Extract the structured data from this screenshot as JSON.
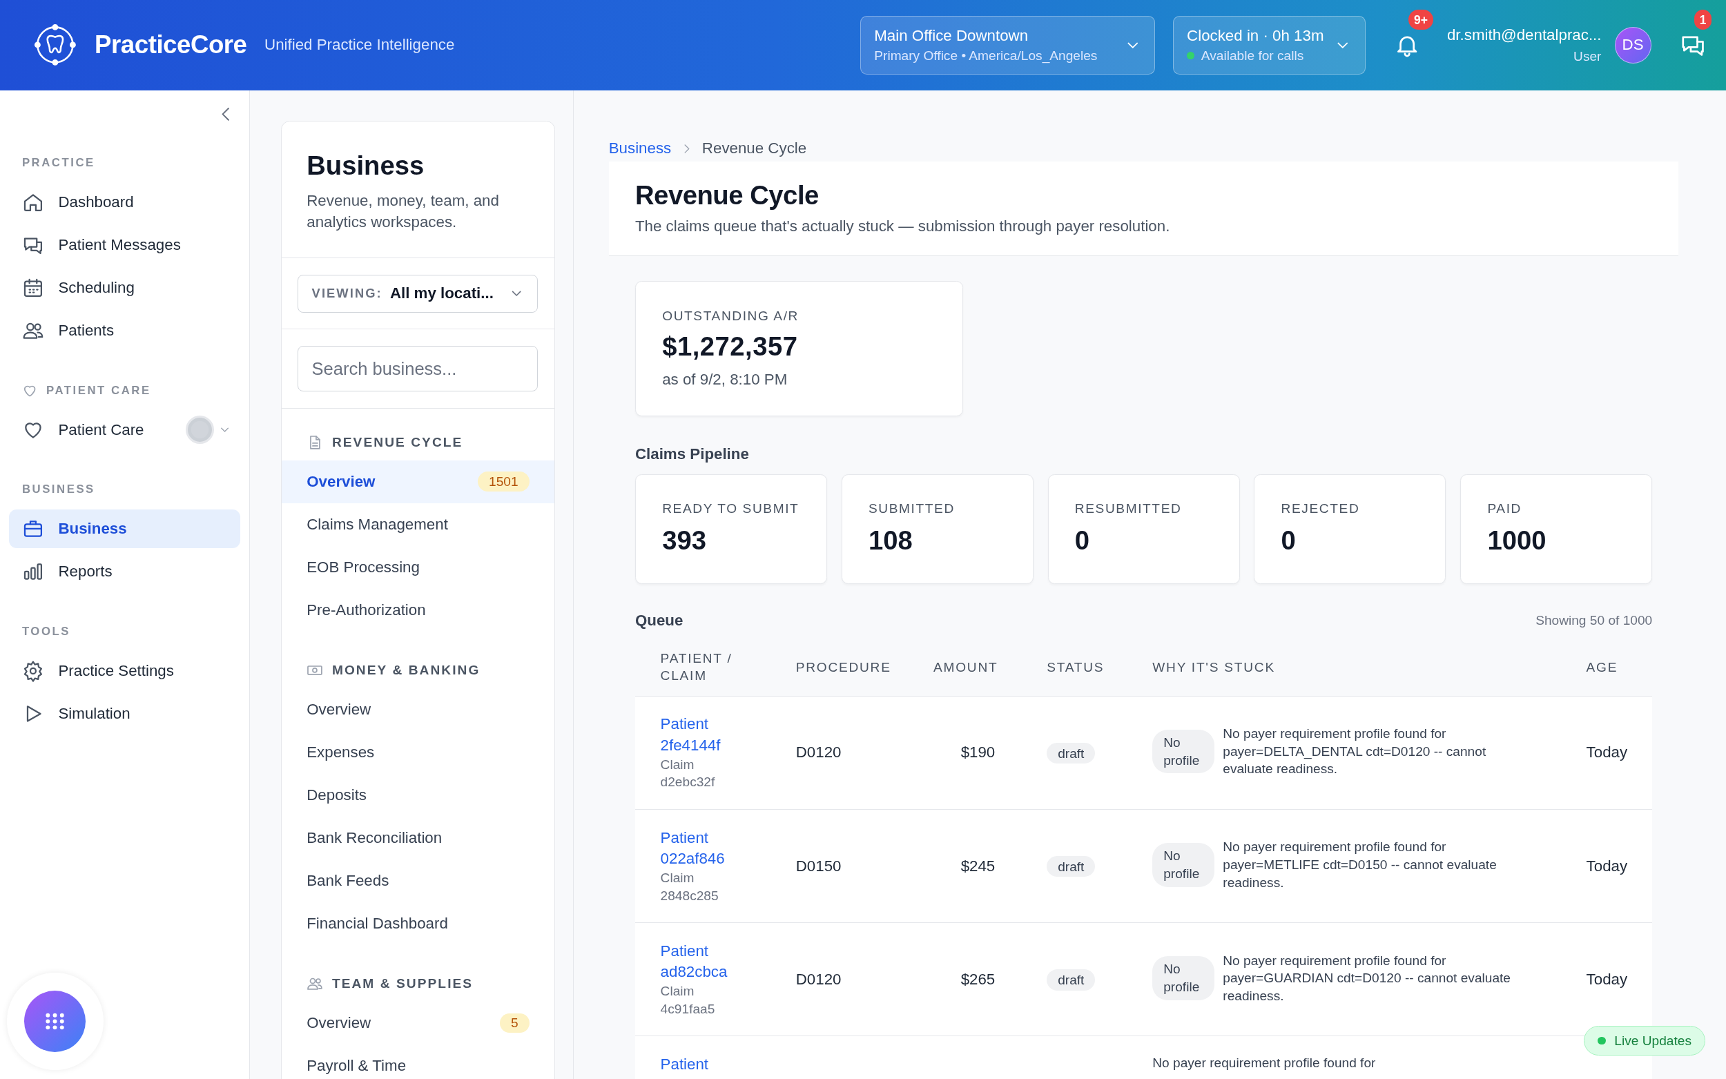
{
  "header": {
    "brand": "PracticeCore",
    "tagline": "Unified Practice Intelligence",
    "location": {
      "name": "Main Office Downtown",
      "detail": "Primary Office • America/Los_Angeles"
    },
    "clock": {
      "status": "Clocked in · 0h 13m",
      "availability": "Available for calls",
      "available": true
    },
    "notifications_badge": "9+",
    "user": {
      "email": "dr.smith@dentalprac...",
      "role": "User",
      "initials": "DS"
    },
    "messages_badge": "1"
  },
  "sidebar": {
    "sections": [
      {
        "label": "PRACTICE",
        "items": [
          {
            "label": "Dashboard",
            "selected": false
          },
          {
            "label": "Patient Messages",
            "selected": false
          },
          {
            "label": "Scheduling",
            "selected": false
          },
          {
            "label": "Patients",
            "selected": false
          }
        ]
      },
      {
        "label": "PATIENT CARE",
        "items": [
          {
            "label": "Patient Care",
            "selected": false,
            "on": false,
            "expanded": false
          }
        ]
      },
      {
        "label": "BUSINESS",
        "items": [
          {
            "label": "Business",
            "selected": true
          },
          {
            "label": "Reports",
            "selected": false
          }
        ]
      },
      {
        "label": "TOOLS",
        "items": [
          {
            "label": "Practice Settings",
            "selected": false
          },
          {
            "label": "Simulation",
            "selected": false
          }
        ]
      }
    ]
  },
  "business_panel": {
    "title": "Business",
    "description": "Revenue, money, team, and analytics workspaces.",
    "viewing": {
      "label": "VIEWING:",
      "value": "All my locati..."
    },
    "search": {
      "placeholder": "Search business..."
    },
    "groups": [
      {
        "title": "REVENUE CYCLE",
        "items": [
          {
            "label": "Overview",
            "selected": true,
            "badge": "1501"
          },
          {
            "label": "Claims Management",
            "selected": false
          },
          {
            "label": "EOB Processing",
            "selected": false
          },
          {
            "label": "Pre-Authorization",
            "selected": false
          }
        ]
      },
      {
        "title": "MONEY & BANKING",
        "items": [
          {
            "label": "Overview",
            "selected": false
          },
          {
            "label": "Expenses",
            "selected": false
          },
          {
            "label": "Deposits",
            "selected": false
          },
          {
            "label": "Bank Reconciliation",
            "selected": false
          },
          {
            "label": "Bank Feeds",
            "selected": false
          },
          {
            "label": "Financial Dashboard",
            "selected": false
          }
        ]
      },
      {
        "title": "TEAM & SUPPLIES",
        "items": [
          {
            "label": "Overview",
            "selected": false,
            "badge": "5"
          },
          {
            "label": "Payroll & Time",
            "selected": false
          }
        ]
      }
    ]
  },
  "main": {
    "breadcrumb": [
      {
        "label": "Business",
        "kind": "link"
      },
      {
        "label": "Revenue Cycle",
        "kind": "current"
      }
    ],
    "title": "Revenue Cycle",
    "subtitle": "The claims queue that's actually stuck — submission through payer resolution.",
    "ar": {
      "label": "OUTSTANDING A/R",
      "value": "$1,272,357",
      "as_of": "as of 9/2, 8:10 PM"
    },
    "pipeline": {
      "title": "Claims Pipeline",
      "stages": [
        {
          "label": "READY TO SUBMIT",
          "value": "393"
        },
        {
          "label": "SUBMITTED",
          "value": "108"
        },
        {
          "label": "RESUBMITTED",
          "value": "0"
        },
        {
          "label": "REJECTED",
          "value": "0"
        },
        {
          "label": "PAID",
          "value": "1000"
        }
      ]
    },
    "queue": {
      "title": "Queue",
      "showing": "Showing 50 of 1000",
      "columns": [
        "PATIENT / CLAIM",
        "PROCEDURE",
        "AMOUNT",
        "STATUS",
        "WHY IT'S STUCK",
        "AGE"
      ],
      "rows": [
        {
          "patient": "Patient 2fe4144f",
          "claim": "Claim d2ebc32f",
          "procedure": "D0120",
          "amount": "$190",
          "status": "draft",
          "reason_badge": "No profile",
          "reason": "No payer requirement profile found for payer=DELTA_DENTAL cdt=D0120 -- cannot evaluate readiness.",
          "age": "Today"
        },
        {
          "patient": "Patient 022af846",
          "claim": "Claim 2848c285",
          "procedure": "D0150",
          "amount": "$245",
          "status": "draft",
          "reason_badge": "No profile",
          "reason": "No payer requirement profile found for payer=METLIFE cdt=D0150 -- cannot evaluate readiness.",
          "age": "Today"
        },
        {
          "patient": "Patient ad82cbca",
          "claim": "Claim 4c91faa5",
          "procedure": "D0120",
          "amount": "$265",
          "status": "draft",
          "reason_badge": "No profile",
          "reason": "No payer requirement profile found for payer=GUARDIAN cdt=D0120 -- cannot evaluate readiness.",
          "age": "Today"
        },
        {
          "patient": "Patient",
          "reason": "No payer requirement profile found for"
        }
      ]
    }
  },
  "live_updates": {
    "label": "Live Updates"
  }
}
